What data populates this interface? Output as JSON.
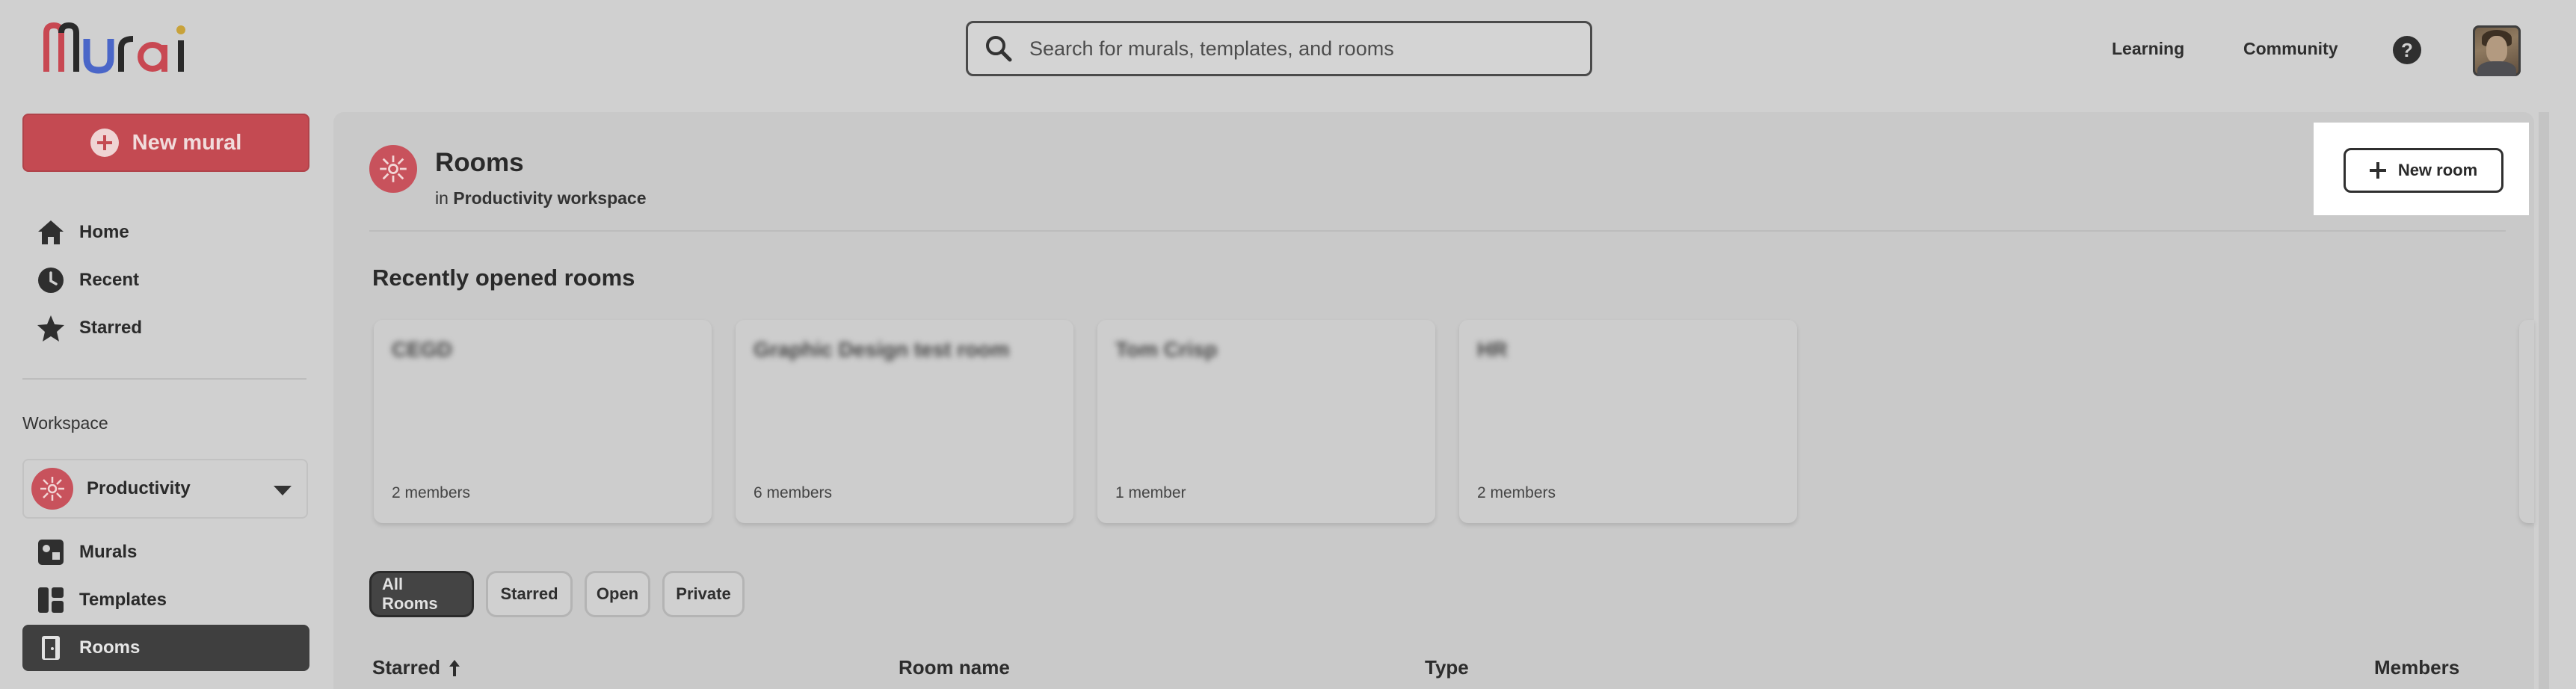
{
  "header": {
    "search_placeholder": "Search for murals, templates, and rooms",
    "links": [
      "Learning",
      "Community"
    ],
    "help_label": "?"
  },
  "sidebar": {
    "new_mural_label": "New mural",
    "primary_items": [
      {
        "label": "Home",
        "icon": "home-icon"
      },
      {
        "label": "Recent",
        "icon": "clock-icon"
      },
      {
        "label": "Starred",
        "icon": "star-icon"
      }
    ],
    "workspace_label": "Workspace",
    "workspace_name": "Productivity",
    "workspace_items": [
      {
        "label": "Murals",
        "icon": "murals-icon"
      },
      {
        "label": "Templates",
        "icon": "templates-icon"
      },
      {
        "label": "Rooms",
        "icon": "rooms-icon",
        "active": true
      }
    ]
  },
  "main": {
    "title": "Rooms",
    "subtitle_prefix": "in",
    "subtitle_workspace": "Productivity workspace",
    "new_room_label": "New room",
    "recent_title": "Recently opened rooms",
    "recent_rooms": [
      {
        "name": "CEGD",
        "members": "2 members"
      },
      {
        "name": "Graphic Design test room",
        "members": "6 members"
      },
      {
        "name": "Tom Crisp",
        "members": "1 member"
      },
      {
        "name": "HR",
        "members": "2 members"
      }
    ],
    "filters": [
      {
        "label": "All Rooms",
        "active": true
      },
      {
        "label": "Starred",
        "active": false
      },
      {
        "label": "Open",
        "active": false
      },
      {
        "label": "Private",
        "active": false
      }
    ],
    "columns": [
      "Starred",
      "Room name",
      "Type",
      "Members"
    ]
  },
  "colors": {
    "brand_red": "#c44a52",
    "background": "#d0d0d0",
    "active_nav": "#3f3f3f"
  }
}
